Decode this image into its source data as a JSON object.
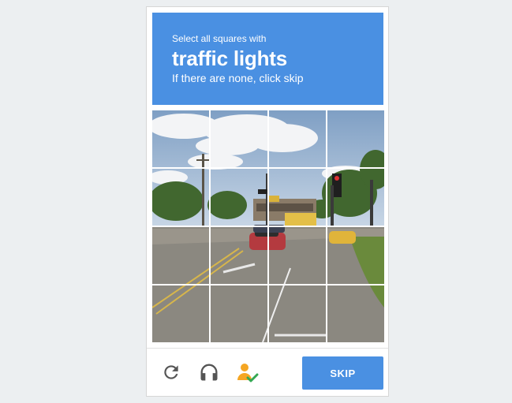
{
  "challenge": {
    "instruction_top": "Select all squares with",
    "target": "traffic lights",
    "instruction_bottom": "If there are none, click skip"
  },
  "grid": {
    "rows": 4,
    "cols": 4
  },
  "toolbar": {
    "reload_icon": "reload-icon",
    "audio_icon": "headphones-icon",
    "info_icon": "person-check-icon",
    "skip_label": "SKIP"
  },
  "colors": {
    "header": "#4a90e2",
    "button": "#4a90e2",
    "icon": "#555555",
    "person": "#f5a623",
    "check": "#34a853"
  }
}
